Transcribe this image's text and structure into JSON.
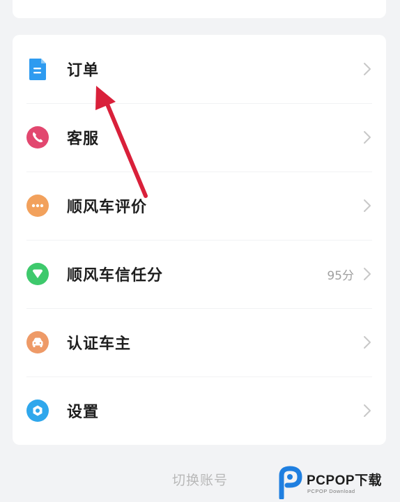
{
  "menu": {
    "items": [
      {
        "label": "订单",
        "icon": "order-document-icon",
        "color": "#2e9bf0",
        "value": ""
      },
      {
        "label": "客服",
        "icon": "phone-icon",
        "color": "#e2476f",
        "value": ""
      },
      {
        "label": "顺风车评价",
        "icon": "chat-bubble-icon",
        "color": "#f2a15c",
        "value": ""
      },
      {
        "label": "顺风车信任分",
        "icon": "heart-badge-icon",
        "color": "#3ec96c",
        "value": "95分"
      },
      {
        "label": "认证车主",
        "icon": "car-icon",
        "color": "#ee9a67",
        "value": ""
      },
      {
        "label": "设置",
        "icon": "settings-gear-icon",
        "color": "#2fa7ec",
        "value": ""
      }
    ]
  },
  "footer": {
    "switch_account": "切换账号"
  },
  "annotation": {
    "arrow_color": "#d9203a"
  },
  "watermark": {
    "brand": "PCPOP下载",
    "sub": "PCPOP Download",
    "color": "#1f7fe0"
  }
}
